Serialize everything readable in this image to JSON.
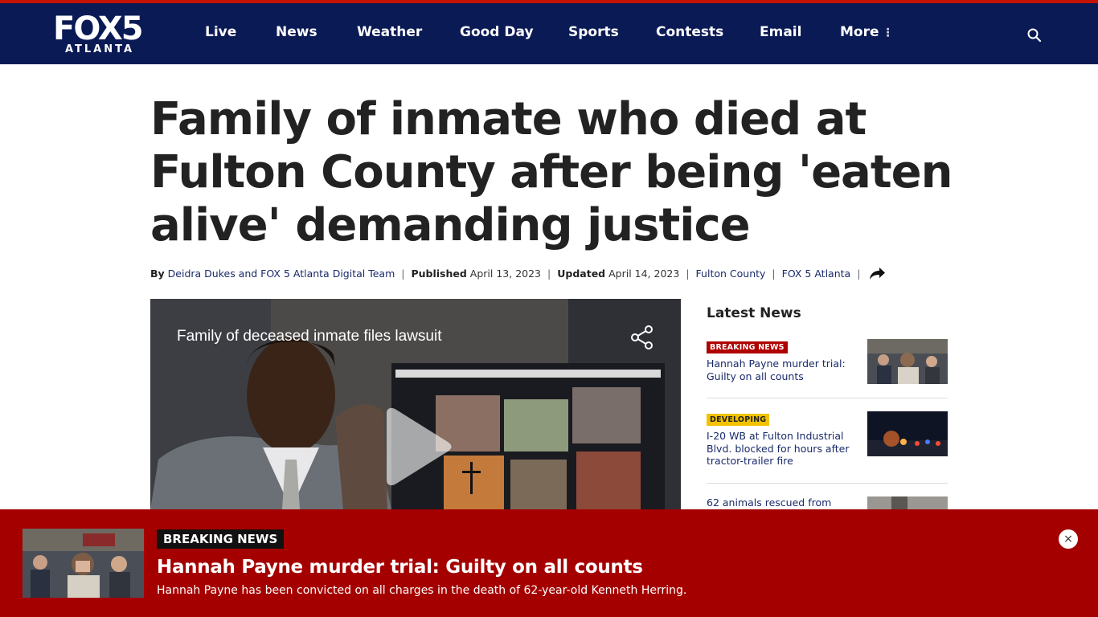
{
  "colors": {
    "header_bg": "#0a1a55",
    "brand_red": "#c41200",
    "alert_bg": "#a50000",
    "link": "#1a2a6a",
    "developing": "#f2c200"
  },
  "logo": {
    "main": "FOX5",
    "sub": "ATLANTA"
  },
  "nav": {
    "items": [
      "Live",
      "News",
      "Weather",
      "Good Day",
      "Sports",
      "Contests",
      "Email",
      "More"
    ],
    "search_icon": "search-icon",
    "more_icon": "vertical-dots-icon"
  },
  "article": {
    "headline": "Family of inmate who died at Fulton County after being 'eaten alive' demanding justice",
    "by_label": "By",
    "authors": "Deidra Dukes and FOX 5 Atlanta Digital Team",
    "published_label": "Published",
    "published_date": "April 13, 2023",
    "updated_label": "Updated",
    "updated_date": "April 14, 2023",
    "tag_1": "Fulton County",
    "tag_2": "FOX 5 Atlanta",
    "share_icon": "share-arrow-icon"
  },
  "video": {
    "title": "Family of deceased inmate files lawsuit",
    "share_icon": "share-icon",
    "play_icon": "play-icon"
  },
  "sidebar": {
    "title": "Latest News",
    "items": [
      {
        "tag": "BREAKING NEWS",
        "text": "Hannah Payne murder trial: Guilty on all counts"
      },
      {
        "tag": "DEVELOPING",
        "text": "I-20 WB at Fulton Industrial Blvd. blocked for hours after tractor-trailer fire"
      },
      {
        "tag": "",
        "text": "62 animals rescued from"
      }
    ]
  },
  "alert": {
    "label": "BREAKING NEWS",
    "headline": "Hannah Payne murder trial: Guilty on all counts",
    "subtext": "Hannah Payne has been convicted on all charges in the death of 62-year-old Kenneth Herring.",
    "close_icon": "close-icon",
    "close_symbol": "×"
  }
}
